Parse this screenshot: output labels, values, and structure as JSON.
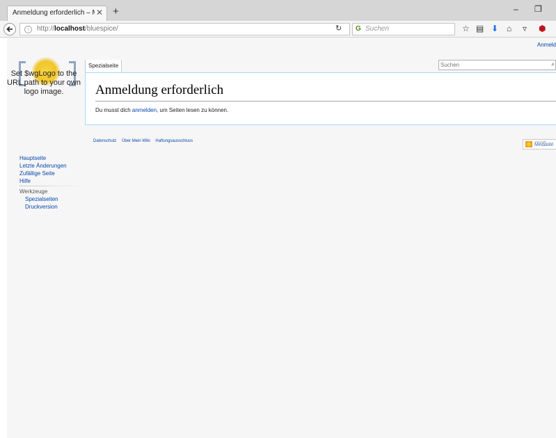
{
  "browser": {
    "tab_title": "Anmeldung erforderlich – Mei…",
    "url_scheme": "http://",
    "url_host": "localhost",
    "url_path": "/bluespice/",
    "search_placeholder": "Suchen"
  },
  "page": {
    "user_link": "Anmeld",
    "logo_text": "Set $wgLogo to the URL path to your own logo image.",
    "tab_label": "Spezialseite",
    "search_placeholder": "Suchen",
    "heading": "Anmeldung erforderlich",
    "body_prefix": "Du musst dich ",
    "body_link": "anmelden",
    "body_suffix": ", um Seiten lesen zu können."
  },
  "sidebar": {
    "items": [
      "Hauptseite",
      "Letzte Änderungen",
      "Zufällige Seite",
      "Hilfe"
    ]
  },
  "tools": {
    "heading": "Werkzeuge",
    "items": [
      "Spezialseiten",
      "Druckversion"
    ]
  },
  "footer": {
    "links": [
      "Datenschutz",
      "Über Mein Wiki",
      "Haftungsausschluss"
    ],
    "powered_small": "Powered By",
    "powered_big": "MediaWi"
  }
}
